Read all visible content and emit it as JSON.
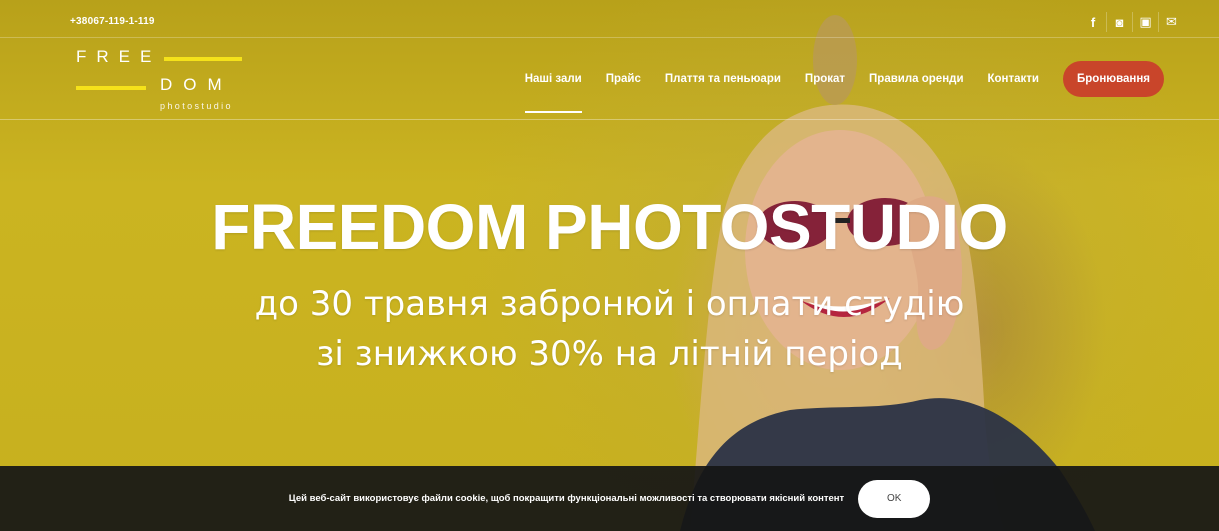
{
  "topbar": {
    "phone": "+38067-119-1-119",
    "social": [
      {
        "icon": "facebook-icon",
        "glyph": "f"
      },
      {
        "icon": "instagram-icon",
        "glyph": "◙"
      },
      {
        "icon": "youtube-icon",
        "glyph": "▣"
      },
      {
        "icon": "mail-icon",
        "glyph": "✉"
      }
    ]
  },
  "logo": {
    "line1": "FREE",
    "line2": "DOM",
    "sub": "photostudio"
  },
  "nav": {
    "items": [
      {
        "label": "Наші зали",
        "active": true
      },
      {
        "label": "Прайс"
      },
      {
        "label": "Плаття та пеньюари"
      },
      {
        "label": "Прокат"
      },
      {
        "label": "Правила оренди"
      },
      {
        "label": "Контакти"
      }
    ],
    "booking": "Бронювання"
  },
  "hero": {
    "title": "FREEDOM PHOTOSTUDIO",
    "line1": "до 30 травня забронюй і оплати студію",
    "line2": "зі знижкою 30% на літній період"
  },
  "cookie": {
    "message": "Цей веб-сайт використовує файли cookie, щоб покращити функціональні можливості та створювати якісний контент",
    "ok": "OK"
  },
  "colors": {
    "background": "#c9b41c",
    "accent_yellow": "#f5e21a",
    "booking_button": "#c9452a",
    "cookie_bar": "#161616"
  }
}
